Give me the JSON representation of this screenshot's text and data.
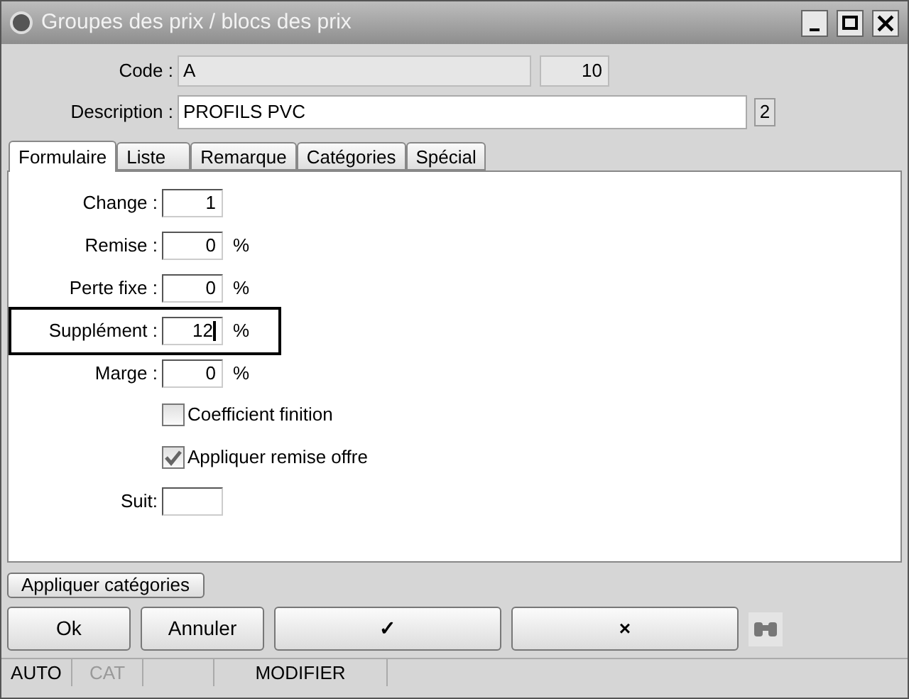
{
  "window": {
    "title": "Groupes des prix / blocs des prix"
  },
  "header": {
    "code_label": "Code :",
    "code_value": "A",
    "code_number": "10",
    "description_label": "Description :",
    "description_value": "PROFILS PVC",
    "description_count": "2"
  },
  "tabs": [
    {
      "label": "Formulaire",
      "selected": true
    },
    {
      "label": "Liste",
      "selected": false
    },
    {
      "label": "Remarque",
      "selected": false
    },
    {
      "label": "Catégories",
      "selected": false
    },
    {
      "label": "Spécial",
      "selected": false
    }
  ],
  "form": [
    {
      "kind": "field",
      "label": "Change :",
      "value": "1",
      "focused": false
    },
    {
      "kind": "field",
      "label": "Remise :",
      "value": "0",
      "suffix": "%",
      "focused": false
    },
    {
      "kind": "field",
      "label": "Perte fixe :",
      "value": "0",
      "suffix": "%",
      "focused": false
    },
    {
      "kind": "field",
      "label": "Supplément :",
      "value": "12",
      "suffix": "%",
      "focused": true
    },
    {
      "kind": "field",
      "label": "Marge :",
      "value": "0",
      "suffix": "%",
      "focused": false
    },
    {
      "kind": "checkbox",
      "label": "Coefficient finition",
      "checked": false
    },
    {
      "kind": "checkbox",
      "label": "Appliquer remise offre",
      "checked": true
    },
    {
      "kind": "field",
      "label": "Suit:",
      "focused": false
    }
  ],
  "apply_button": "Appliquer catégories",
  "buttons": [
    {
      "label": "Ok"
    },
    {
      "label": "Annuler"
    },
    {
      "label": "✓"
    },
    {
      "label": "×"
    }
  ],
  "status_bar": [
    {
      "kind": "text",
      "text": "AUTO",
      "disabled": false
    },
    {
      "kind": "text",
      "text": "CAT",
      "disabled": true
    },
    {
      "kind": "blank"
    },
    {
      "kind": "text",
      "text": "MODIFIER",
      "disabled": false
    }
  ]
}
